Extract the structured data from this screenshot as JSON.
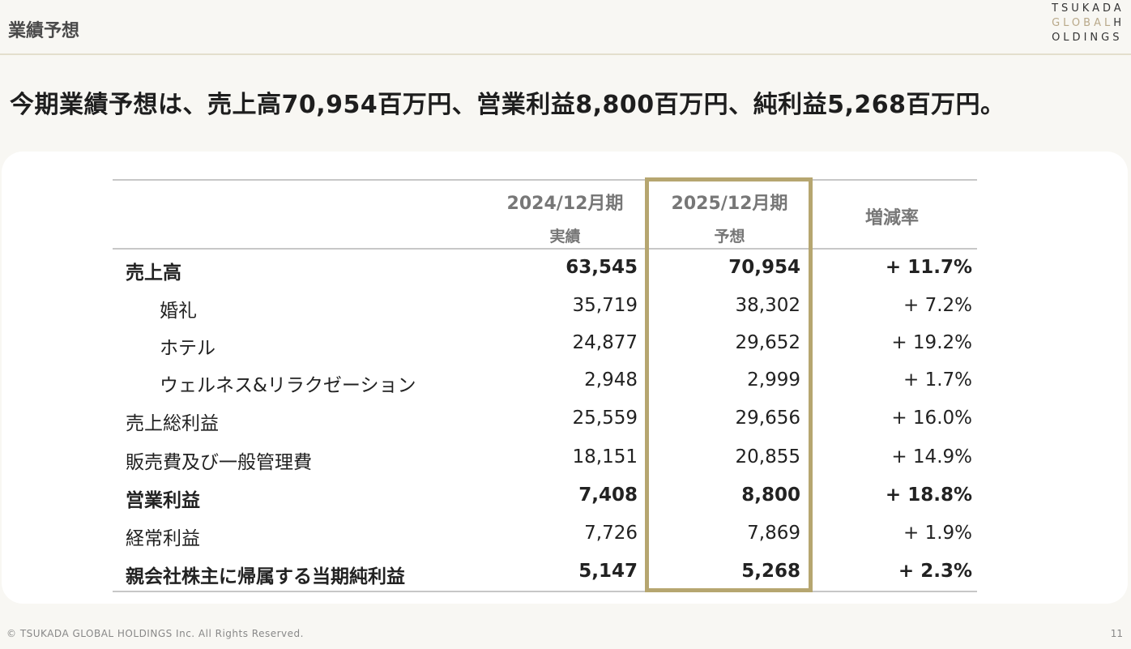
{
  "header": {
    "section_title": "業績予想",
    "logo_line1": "TSUKADA",
    "logo_line2a": "GLOBAL",
    "logo_line2b": "H",
    "logo_line3": "OLDINGS"
  },
  "headline": "今期業績予想は、売上高70,954百万円、営業利益8,800百万円、純利益5,268百万円。",
  "table": {
    "columns": [
      {
        "year": "2024/12月期",
        "sub": "実績"
      },
      {
        "year": "2025/12月期",
        "sub": "予想"
      },
      {
        "year": "増減率"
      }
    ],
    "rows": [
      {
        "label": "売上高",
        "prev": "63,545",
        "forecast": "70,954",
        "rate": "+ 11.7%"
      },
      {
        "label": "婚礼",
        "prev": "35,719",
        "forecast": "38,302",
        "rate": "+ 7.2%"
      },
      {
        "label": "ホテル",
        "prev": "24,877",
        "forecast": "29,652",
        "rate": "+ 19.2%"
      },
      {
        "label": "ウェルネス&リラクゼーション",
        "prev": "2,948",
        "forecast": "2,999",
        "rate": "+ 1.7%"
      },
      {
        "label": "売上総利益",
        "prev": "25,559",
        "forecast": "29,656",
        "rate": "+ 16.0%"
      },
      {
        "label": "販売費及び一般管理費",
        "prev": "18,151",
        "forecast": "20,855",
        "rate": "+ 14.9%"
      },
      {
        "label": "営業利益",
        "prev": "7,408",
        "forecast": "8,800",
        "rate": "+ 18.8%"
      },
      {
        "label": "経常利益",
        "prev": "7,726",
        "forecast": "7,869",
        "rate": "+ 1.9%"
      },
      {
        "label": "親会社株主に帰属する当期純利益",
        "prev": "5,147",
        "forecast": "5,268",
        "rate": "+ 2.3%"
      }
    ]
  },
  "footer": {
    "copyright": "© TSUKADA GLOBAL HOLDINGS Inc. All Rights Reserved.",
    "page_number": "11"
  },
  "colors": {
    "highlight_border": "#b6a670",
    "background": "#f8f7f3"
  }
}
